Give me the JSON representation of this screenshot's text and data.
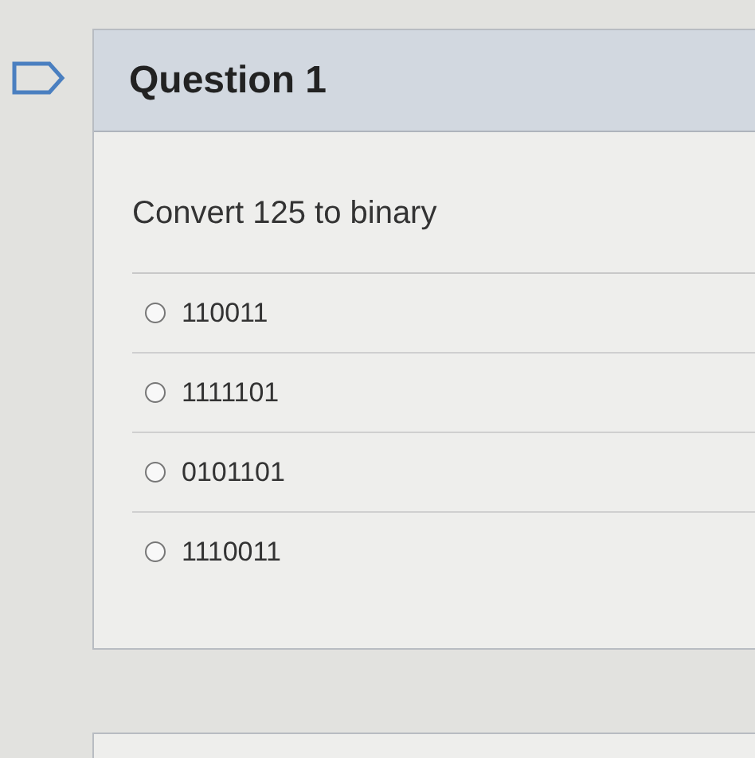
{
  "question": {
    "title": "Question 1",
    "prompt": "Convert 125 to binary",
    "options": [
      {
        "label": "110011",
        "selected": false
      },
      {
        "label": "1111101",
        "selected": false
      },
      {
        "label": "0101101",
        "selected": false
      },
      {
        "label": "1110011",
        "selected": false
      }
    ]
  }
}
